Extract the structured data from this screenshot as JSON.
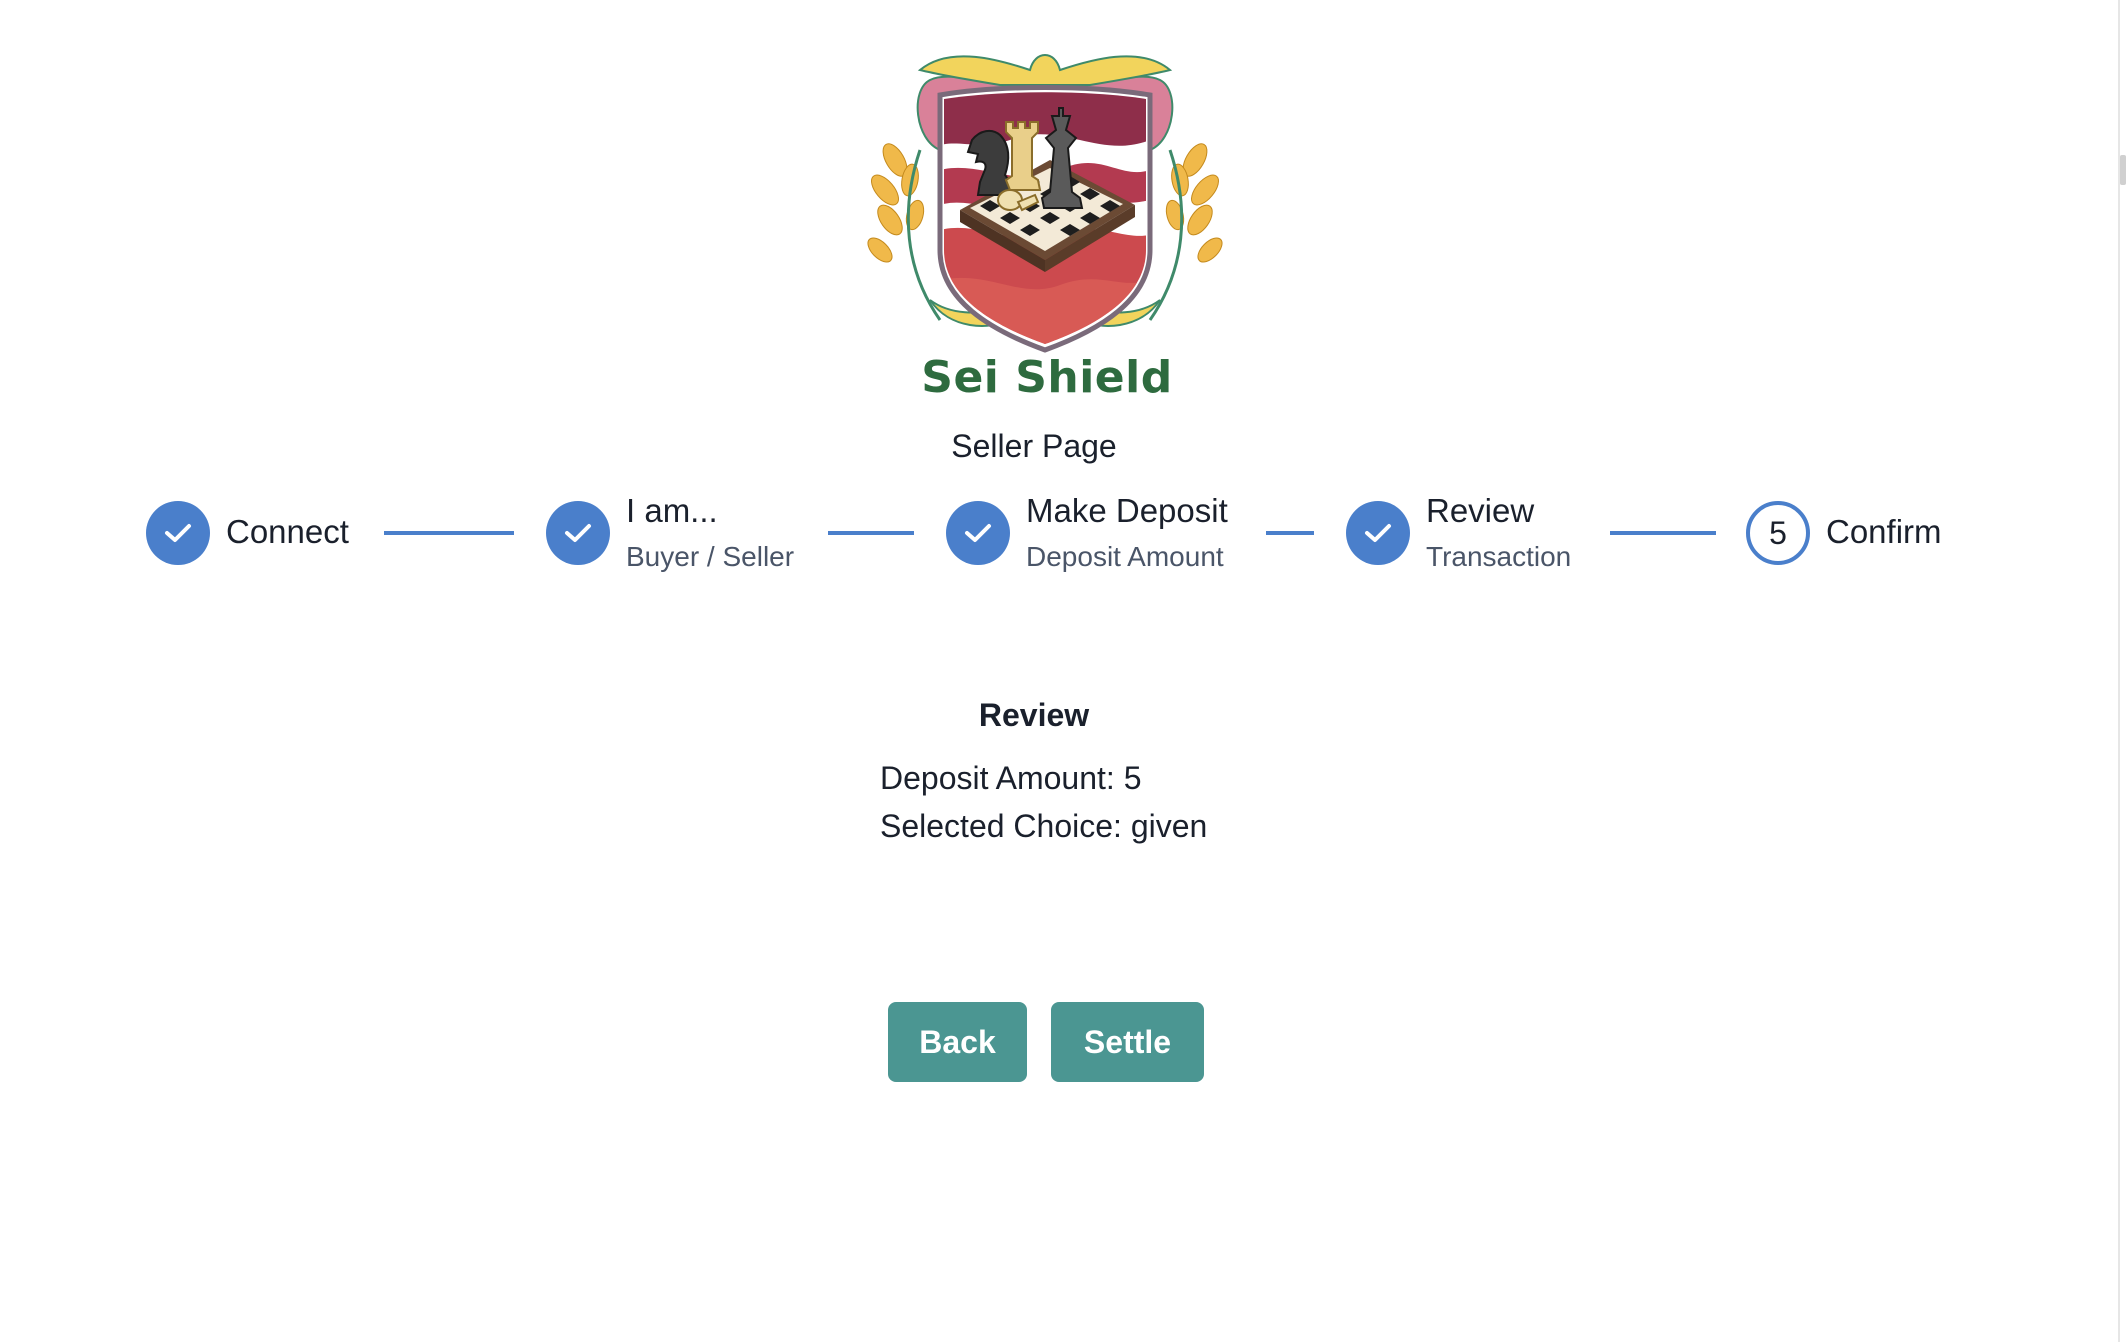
{
  "brand": {
    "name": "Sei Shield"
  },
  "page": {
    "subtitle": "Seller Page"
  },
  "stepper": {
    "steps": [
      {
        "title": "Connect",
        "description": "",
        "status": "complete"
      },
      {
        "title": "I am...",
        "description": "Buyer / Seller",
        "status": "complete"
      },
      {
        "title": "Make Deposit",
        "description": "Deposit Amount",
        "status": "complete"
      },
      {
        "title": "Review",
        "description": "Transaction",
        "status": "complete"
      },
      {
        "title": "Confirm",
        "description": "",
        "status": "pending",
        "number": "5"
      }
    ]
  },
  "review": {
    "heading": "Review",
    "deposit_amount": "Deposit Amount: 5",
    "selected_choice": "Selected Choice: given"
  },
  "actions": {
    "back_label": "Back",
    "settle_label": "Settle"
  },
  "colors": {
    "accent": "#4a7fcb",
    "button": "#4b9692",
    "brand": "#2e6b3f"
  }
}
